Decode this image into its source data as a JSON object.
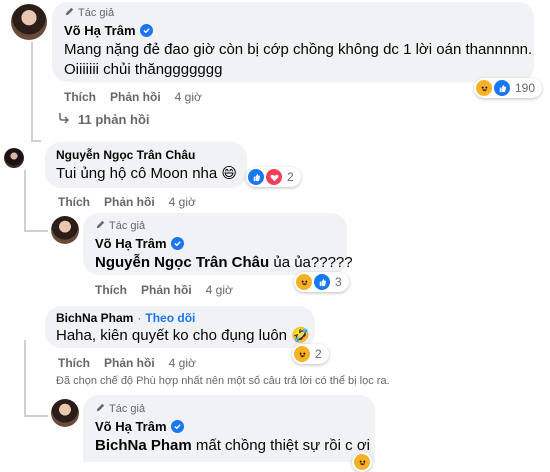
{
  "comment1": {
    "author_tag": "Tác giả",
    "name": "Võ Hạ Trâm",
    "text_line1": "Mang nặng đẻ đao giờ còn bị cớp chồng không dc 1 lời oán thannnnn.",
    "text_line2": "Oiiiiiii chủi thănggggggg",
    "like": "Thích",
    "reply": "Phản hồi",
    "time": "4 giờ",
    "reaction_count": "190",
    "replies_toggle": "11 phản hồi"
  },
  "comment2": {
    "name": "Nguyễn Ngọc Trân Châu",
    "text": "Tui ủng hộ cô Moon nha 😄",
    "like": "Thích",
    "reply": "Phản hồi",
    "time": "4 giờ",
    "reaction_count": "2"
  },
  "comment3": {
    "author_tag": "Tác giả",
    "name": "Võ Hạ Trâm",
    "mention": "Nguyễn Ngọc Trân Châu",
    "text": " ủa ủa?????",
    "like": "Thích",
    "reply": "Phản hồi",
    "time": "4 giờ",
    "reaction_count": "3"
  },
  "comment4": {
    "name": "BichNa Pham",
    "follow": "Theo dõi",
    "text": "Haha, kiên quyết ko cho đụng luôn 🤣",
    "like": "Thích",
    "reply": "Phản hồi",
    "time": "4 giờ",
    "reaction_count": "2"
  },
  "filter_note": "Đã chọn chế độ Phù hợp nhất nên một số câu trả lời có thể bị lọc ra.",
  "comment5": {
    "author_tag": "Tác giả",
    "name": "Võ Hạ Trâm",
    "mention": "BichNa Pham",
    "text": " mất chồng thiệt sự rồi c ơi"
  },
  "colors": {
    "accent": "#1877f2",
    "bubble": "#f0f2f5",
    "muted": "#65676b"
  }
}
